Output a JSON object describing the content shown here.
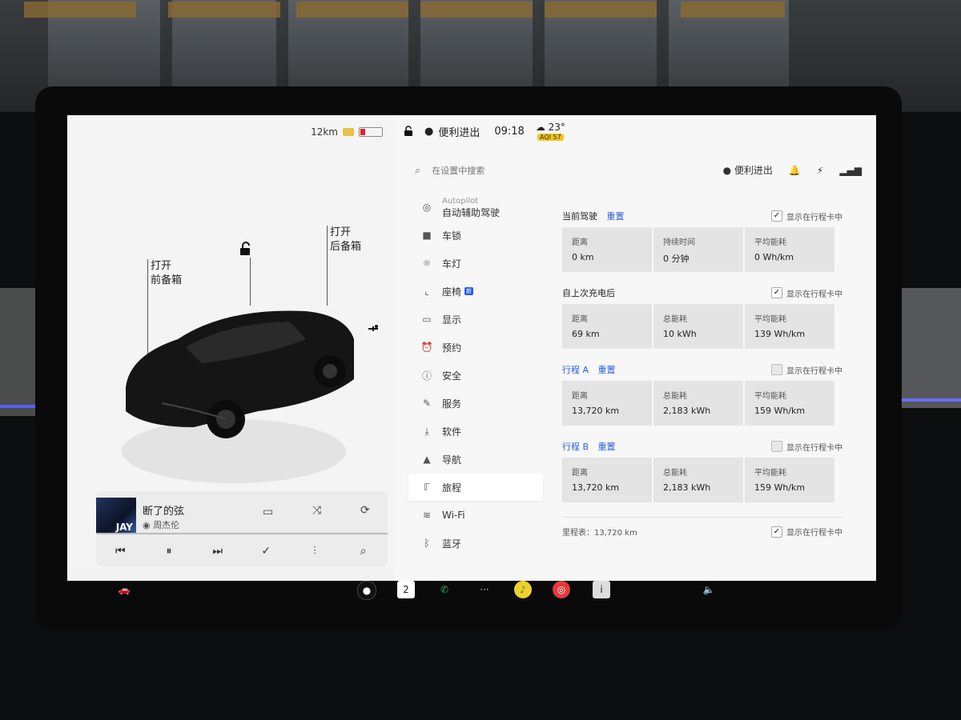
{
  "left_pane": {
    "range": "12km",
    "frunk": {
      "line1": "打开",
      "line2": "前备箱"
    },
    "trunk": {
      "line1": "打开",
      "line2": "后备箱"
    },
    "media": {
      "song": "断了的弦",
      "artist": "周杰伦",
      "album_text": "JAY"
    }
  },
  "status_bar": {
    "profile": "便利进出",
    "time": "09:18",
    "temperature": "23°",
    "aqi": "AQI 57"
  },
  "search": {
    "placeholder": "在设置中搜索",
    "profile": "便利进出"
  },
  "menu": [
    {
      "label": "自动辅助驾驶",
      "sub": "Autopilot",
      "icon": "steering-wheel-icon"
    },
    {
      "label": "车锁",
      "icon": "lock-icon"
    },
    {
      "label": "车灯",
      "icon": "light-icon"
    },
    {
      "label": "座椅",
      "badge": "新",
      "icon": "seat-icon"
    },
    {
      "label": "显示",
      "icon": "display-icon"
    },
    {
      "label": "预约",
      "icon": "alarm-icon"
    },
    {
      "label": "安全",
      "icon": "info-circle-icon"
    },
    {
      "label": "服务",
      "icon": "wrench-icon"
    },
    {
      "label": "软件",
      "icon": "download-icon"
    },
    {
      "label": "导航",
      "icon": "navigation-icon"
    },
    {
      "label": "旅程",
      "icon": "trip-icon"
    },
    {
      "label": "Wi-Fi",
      "icon": "wifi-icon"
    },
    {
      "label": "蓝牙",
      "icon": "bluetooth-icon"
    }
  ],
  "trips": {
    "show_label": "显示在行程卡中",
    "reset_label": "重置",
    "current": {
      "title": "当前驾驶",
      "checked": true,
      "cards": [
        {
          "label": "距离",
          "value": "0 km"
        },
        {
          "label": "持续时间",
          "value": "0 分钟"
        },
        {
          "label": "平均能耗",
          "value": "0 Wh/km"
        }
      ]
    },
    "since_charge": {
      "title": "自上次充电后",
      "checked": true,
      "cards": [
        {
          "label": "距离",
          "value": "69 km"
        },
        {
          "label": "总能耗",
          "value": "10 kWh"
        },
        {
          "label": "平均能耗",
          "value": "139 Wh/km"
        }
      ]
    },
    "trip_a": {
      "title": "行程 A",
      "checked": false,
      "cards": [
        {
          "label": "距离",
          "value": "13,720 km"
        },
        {
          "label": "总能耗",
          "value": "2,183 kWh"
        },
        {
          "label": "平均能耗",
          "value": "159 Wh/km"
        }
      ]
    },
    "trip_b": {
      "title": "行程 B",
      "checked": false,
      "cards": [
        {
          "label": "距离",
          "value": "13,720 km"
        },
        {
          "label": "总能耗",
          "value": "2,183 kWh"
        },
        {
          "label": "平均能耗",
          "value": "159 Wh/km"
        }
      ]
    },
    "odometer": "里程表：13,720 km",
    "odometer_checked": true
  },
  "bottom_bar": {
    "calendar_day": "2",
    "dots": "···",
    "colors": {
      "phone": "#24b35a",
      "music": "#f0d12b",
      "netease": "#e23b3b",
      "calendar": "#ffffff"
    }
  }
}
